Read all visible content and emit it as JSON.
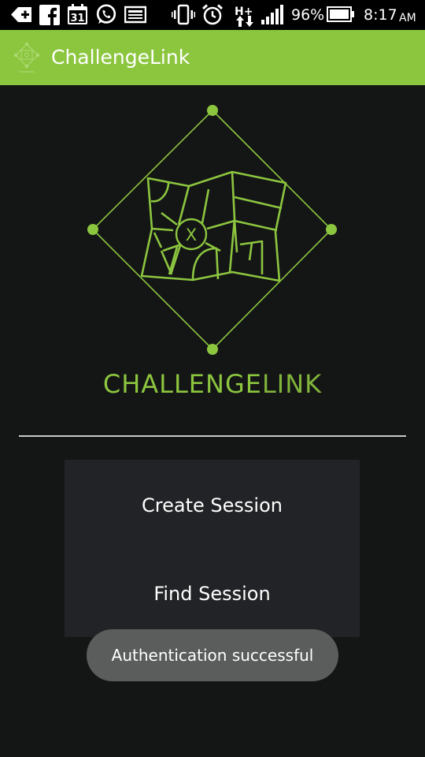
{
  "status_bar": {
    "battery_percent": "96%",
    "time": "8:17",
    "ampm": "AM",
    "calendar_day": "31",
    "network_type": "H+",
    "icons_left": [
      "back-arrow-plus-icon",
      "facebook-icon",
      "calendar-icon",
      "whatsapp-icon",
      "image-icon"
    ],
    "icons_right": [
      "vibrate-icon",
      "alarm-icon",
      "network-data-icon",
      "signal-icon",
      "battery-icon"
    ]
  },
  "app_bar": {
    "title": "ChallengeLink",
    "color": "#8cc63f"
  },
  "hero": {
    "brand_bold": "CHALLENGE",
    "brand_light": "LINK",
    "center_mark": "X",
    "accent_color": "#8cc63f"
  },
  "menu": {
    "items": [
      {
        "label": "Create Session"
      },
      {
        "label": "Find Session"
      }
    ]
  },
  "toast": {
    "message": "Authentication successful"
  }
}
